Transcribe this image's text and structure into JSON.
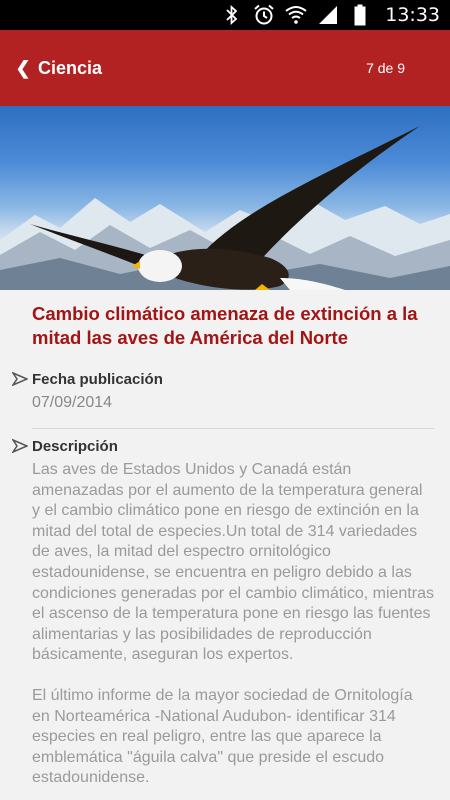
{
  "status_bar": {
    "time": "13:33",
    "icons": [
      "bluetooth-icon",
      "alarm-icon",
      "wifi-icon",
      "signal-icon",
      "battery-icon"
    ]
  },
  "app_bar": {
    "back_icon": "chevron-left-icon",
    "title": "Ciencia",
    "pager": "7 de 9",
    "color": "#b22222"
  },
  "article": {
    "headline": "Cambio climático amenaza de extinción a la mitad las aves de América del Norte",
    "headline_color": "#a31515",
    "fields": {
      "date_label": "Fecha publicación",
      "date_value": "07/09/2014",
      "description_label": "Descripción",
      "description_paragraphs": [
        "Las aves de Estados Unidos y Canadá están amenazadas por el aumento de la temperatura general y el cambio climático pone en riesgo de extinción en la mitad del total de especies.Un total de 314 variedades de aves, la mitad del espectro ornitológico estadounidense, se encuentra en peligro debido a las condiciones generadas por el cambio climático, mientras el ascenso de la temperatura pone en riesgo las fuentes alimentarias y las posibilidades de reproducción básicamente, aseguran los expertos.",
        "El último informe de la mayor sociedad de Ornitología en Norteamérica -National Audubon- identificar 314 especies en real peligro, entre las que aparece la emblemática \"águila calva\" que preside el escudo estadounidense."
      ]
    }
  }
}
